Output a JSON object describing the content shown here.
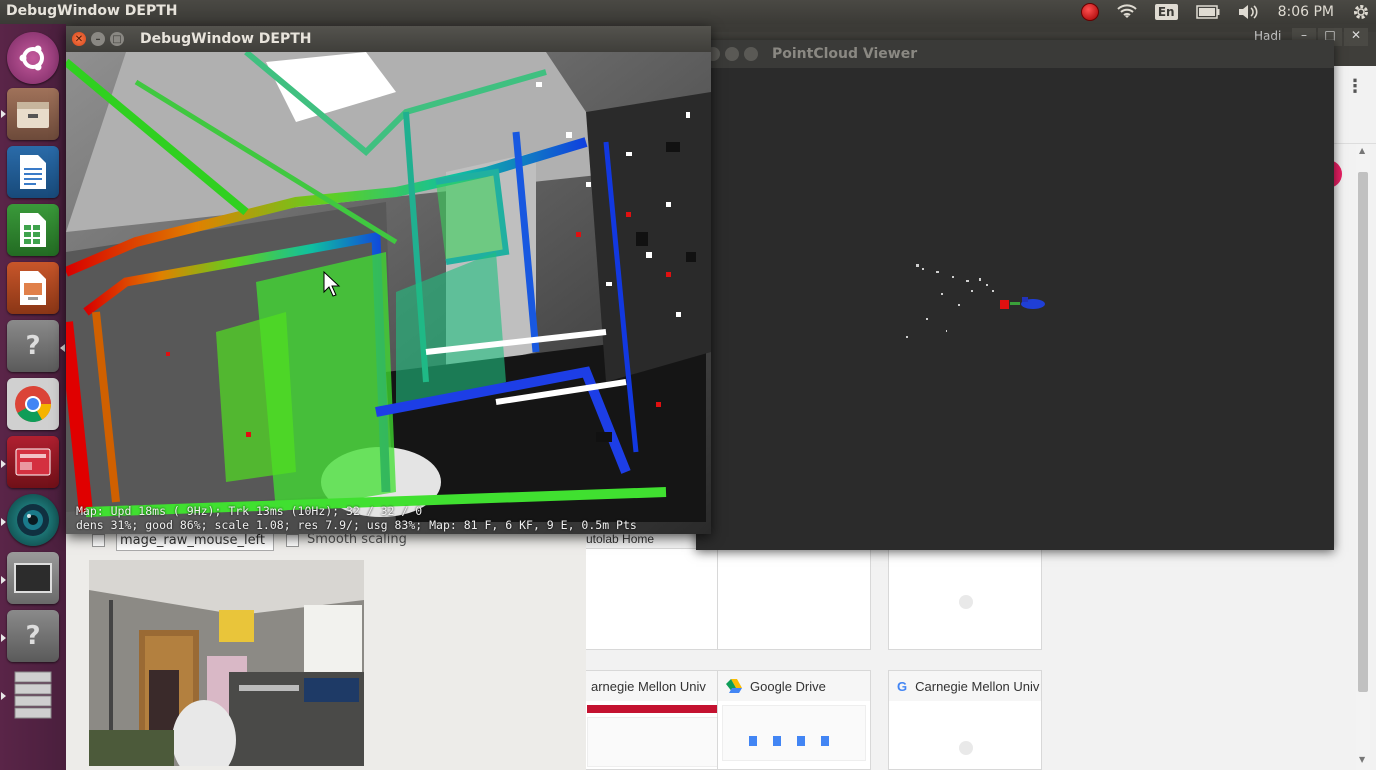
{
  "topbar": {
    "app_title": "DebugWindow DEPTH",
    "keyboard_layout": "En",
    "clock": "8:06 PM"
  },
  "icons": {
    "record": "record-indicator-icon",
    "wifi": "wifi-icon",
    "battery": "battery-icon",
    "volume": "volume-icon",
    "settings": "gear-icon"
  },
  "depth_window": {
    "title": "DebugWindow DEPTH",
    "status_line_1": "Map: Upd  18ms ( 9Hz); Trk  13ms (10Hz); 32 / 32 / 0",
    "status_line_2": "dens 31%; good 86%; scale 1.08; res 7.9/; usg 83%; Map: 81 F, 6 KF, 9 E, 0.5m Pts"
  },
  "pointcloud_window": {
    "title": "PointCloud Viewer"
  },
  "chrome_window": {
    "user": "Hadi",
    "bookmark": "utolab Home",
    "tiles": [
      {
        "label": "arnegie Mellon Univ"
      },
      {
        "label": "Google Drive"
      },
      {
        "label": "Carnegie Mellon Univ"
      }
    ]
  },
  "image_window": {
    "topic_field": "mage_raw_mouse_left",
    "smooth_scaling_label": "Smooth scaling"
  },
  "colors": {
    "launcher_bg": "#5a2548",
    "topbar_bg": "#3c3b37",
    "pointcloud_bg": "#2b2b2b",
    "accent": "#e95420"
  }
}
